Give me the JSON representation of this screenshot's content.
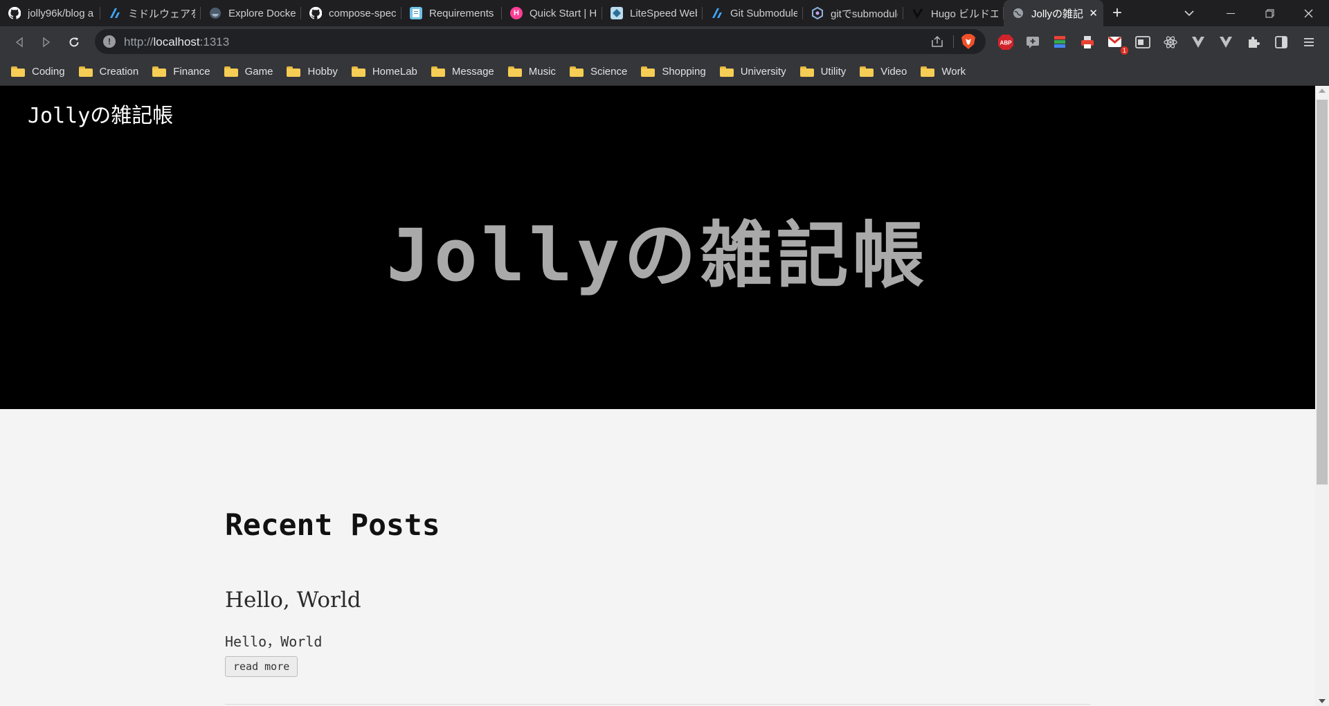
{
  "browser": {
    "tabs": [
      {
        "title": "jolly96k/blog a",
        "icon": "github-icon",
        "color": "#ffffff"
      },
      {
        "title": "ミドルウェアを使う",
        "icon": "zenn-icon",
        "color": "#3ea8ff"
      },
      {
        "title": "Explore Docker",
        "icon": "docker-icon",
        "color": "#7a8fa6"
      },
      {
        "title": "compose-spec",
        "icon": "github-icon",
        "color": "#ffffff"
      },
      {
        "title": "Requirements",
        "icon": "doc-icon",
        "color": "#6fc3e8"
      },
      {
        "title": "Quick Start | H",
        "icon": "hugo-icon",
        "color": "#ff3f97"
      },
      {
        "title": "LiteSpeed Web",
        "icon": "litespeed-icon",
        "color": "#b9dcef"
      },
      {
        "title": "Git Submodule",
        "icon": "zenn-icon",
        "color": "#3ea8ff"
      },
      {
        "title": "gitでsubmodule",
        "icon": "qiita-icon",
        "color": "#8fb3e0"
      },
      {
        "title": "Hugo ビルドエラ",
        "icon": "note-icon",
        "color": "#111111"
      }
    ],
    "active_tab": {
      "title": "Jollyの雑記",
      "icon": "globe-icon"
    },
    "new_tab_label": "+",
    "url": {
      "scheme": "http://",
      "host": "localhost",
      "port": ":1313"
    },
    "bookmarks": [
      "Coding",
      "Creation",
      "Finance",
      "Game",
      "Hobby",
      "HomeLab",
      "Message",
      "Music",
      "Science",
      "Shopping",
      "University",
      "Utility",
      "Video",
      "Work"
    ],
    "gmail_badge": "1",
    "abp_label": "ABP"
  },
  "site": {
    "header_title": "Jollyの雑記帳",
    "hero_title": "Jollyの雑記帳",
    "section_title": "Recent Posts",
    "posts": [
      {
        "title": "Hello, World",
        "summary": "Hello，World",
        "read_more": "read more"
      }
    ]
  },
  "colors": {
    "hero_bg": "#000000",
    "page_bg": "#f4f4f4",
    "hero_text": "#a9a9a9"
  }
}
